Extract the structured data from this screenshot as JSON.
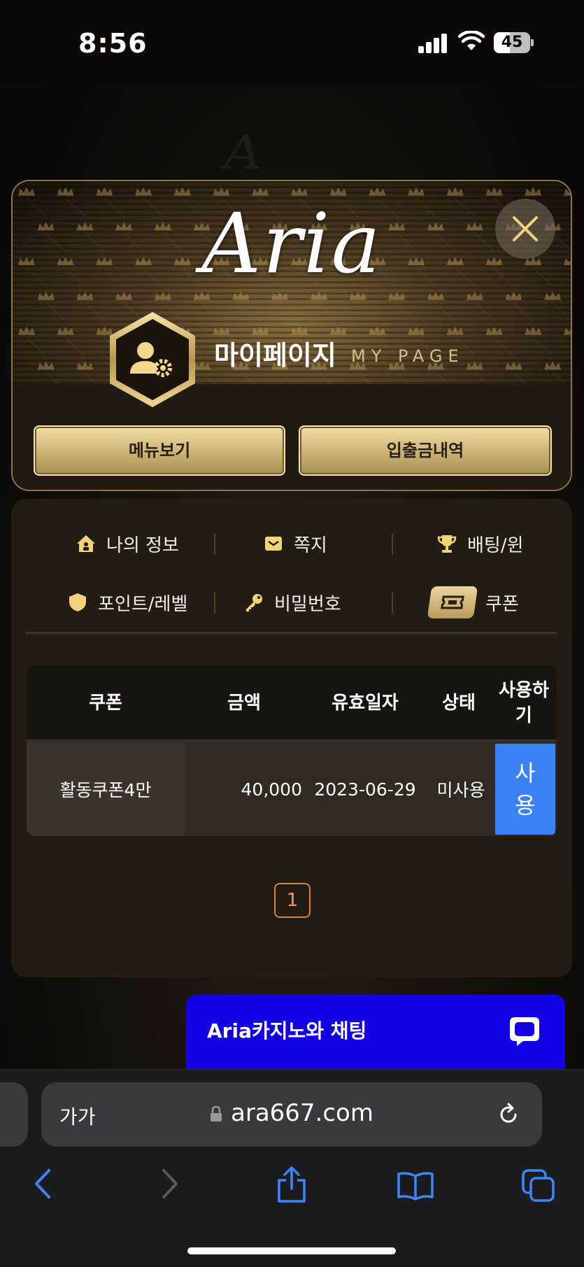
{
  "status_bar": {
    "time": "8:56",
    "battery": "45",
    "battery_level": 0.45
  },
  "header": {
    "logo": "Aria",
    "title": "마이페이지",
    "subtitle": "MY PAGE",
    "menu_button": "메뉴보기",
    "deposit_history_button": "입출금내역"
  },
  "tabs": [
    {
      "label": "나의 정보",
      "icon": "home-icon"
    },
    {
      "label": "쪽지",
      "icon": "envelope-icon"
    },
    {
      "label": "배팅/윈",
      "icon": "trophy-icon"
    },
    {
      "label": "포인트/레벨",
      "icon": "shield-icon"
    },
    {
      "label": "비밀번호",
      "icon": "key-icon"
    },
    {
      "label": "쿠폰",
      "icon": "ticket-icon",
      "active": true
    }
  ],
  "coupon_table": {
    "headers": [
      "쿠폰",
      "금액",
      "유효일자",
      "상태",
      "사용하\n기"
    ],
    "rows": [
      {
        "name": "활동쿠폰4만",
        "amount": "40,000",
        "expiry": "2023-06-29",
        "status": "미사용",
        "action": "사\n용"
      }
    ]
  },
  "pagination": {
    "current": "1"
  },
  "chat": {
    "label": "Aria카지노와 채팅"
  },
  "browser": {
    "text_size": "가가",
    "url": "ara667.com"
  },
  "colors": {
    "gold": "#cbb174",
    "chat_blue": "#1400e6",
    "use_button": "#3b82f6",
    "pager": "#e0823a"
  }
}
